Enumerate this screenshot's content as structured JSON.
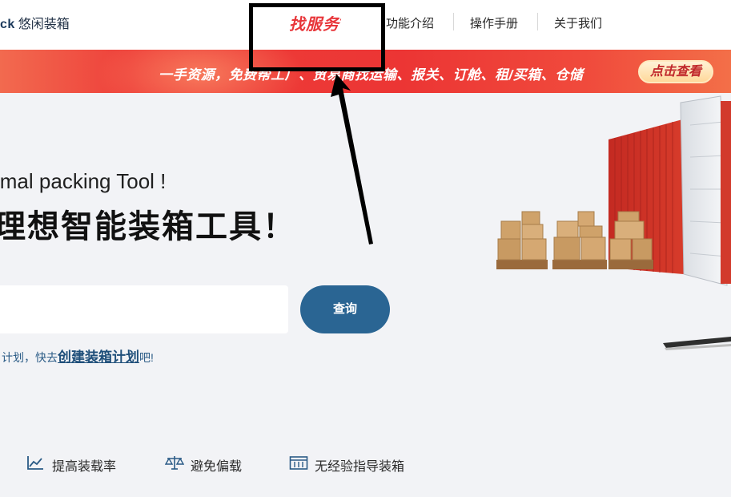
{
  "topnav": {
    "brand_latin": "ck",
    "brand_cn": "悠闲装箱",
    "service": "找服务",
    "service_mark": "'",
    "items": [
      "功能介绍",
      "操作手册",
      "关于我们"
    ]
  },
  "banner": {
    "text": "一手资源，免费帮工厂、贸易商找运输、报关、订舱、租/买箱、仓储",
    "button": "点击查看"
  },
  "hero": {
    "subtitle": "imal packing Tool !",
    "title": "理想智能装箱工具！"
  },
  "search": {
    "value": "",
    "placeholder": "",
    "button": "查询"
  },
  "hint": {
    "prefix": "计划，快去",
    "link": "创建装箱计划",
    "suffix": "吧!"
  },
  "features": [
    {
      "icon": "line-chart-icon",
      "label": "提高装载率"
    },
    {
      "icon": "balance-scale-icon",
      "label": "避免偏载"
    },
    {
      "icon": "container-icon",
      "label": "无经验指导装箱"
    }
  ],
  "colors": {
    "accent_red": "#e8363a",
    "primary_blue": "#2a6593",
    "banner_red": "#ec3534",
    "container_red": "#d9332b"
  }
}
